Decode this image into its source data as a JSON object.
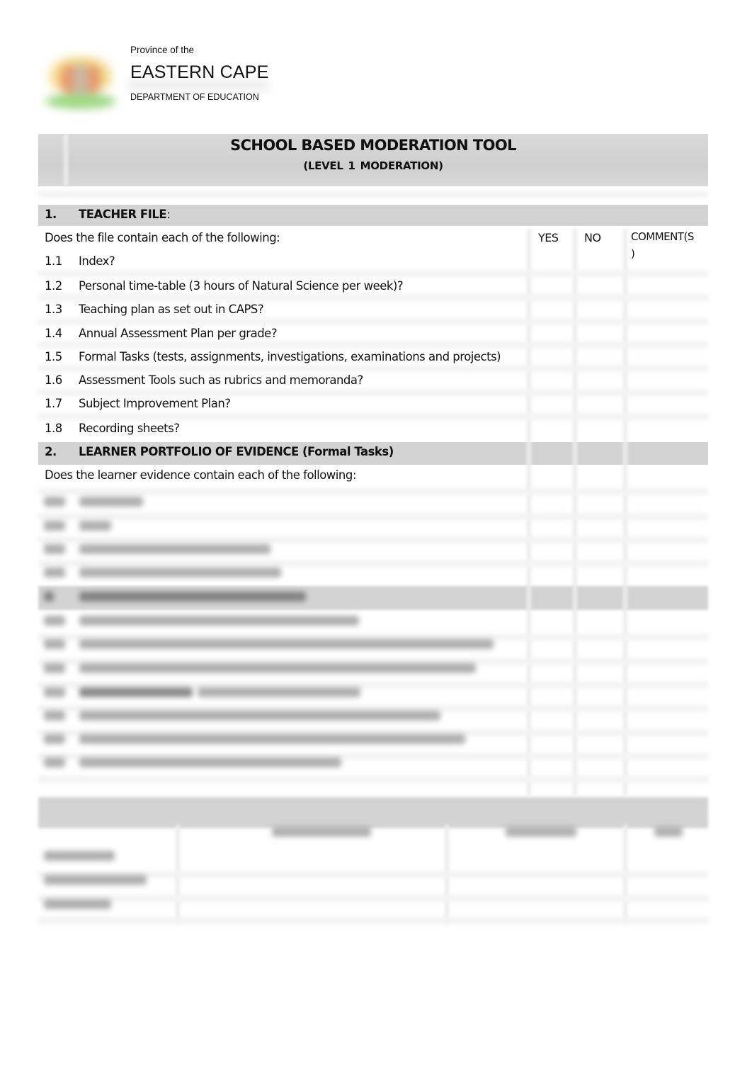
{
  "header": {
    "logo": "eastern-cape-coat-of-arms",
    "province_prefix": "Province of the",
    "province_name": "EASTERN CAPE",
    "department": "DEPARTMENT OF EDUCATION"
  },
  "document": {
    "title": "SCHOOL BASED MODERATION TOOL",
    "subtitle": "(LEVEL 1   MODERATION)"
  },
  "columns": {
    "yes": "YES",
    "no": "NO",
    "comments": "COMMENT(S",
    "comments_wrap": ")"
  },
  "section1": {
    "number": "1.",
    "heading": "TEACHER FILE",
    "heading_suffix": ":",
    "prompt": "Does the file contain each of the following:",
    "items": [
      {
        "num": "1.1",
        "text": "Index?"
      },
      {
        "num": "1.2",
        "text": "Personal time-table (3 hours of Natural Science per week)?"
      },
      {
        "num": "1.3",
        "text": "Teaching plan as set out in CAPS?"
      },
      {
        "num": "1.4",
        "text": "Annual Assessment Plan per grade?"
      },
      {
        "num": "1.5",
        "text": "Formal Tasks (tests, assignments, investigations, examinations and projects)"
      },
      {
        "num": "1.6",
        "text": "Assessment Tools such as rubrics and memoranda?"
      },
      {
        "num": "1.7",
        "text": "Subject Improvement Plan?"
      },
      {
        "num": "1.8",
        "text": "Recording sheets?"
      }
    ]
  },
  "section2": {
    "number": "2.",
    "heading": "LEARNER PORTFOLIO OF EVIDENCE (Formal Tasks)",
    "prompt": "Does the learner evidence contain each of the following:"
  },
  "obscured_note": "Remaining content is blurred / not legible"
}
